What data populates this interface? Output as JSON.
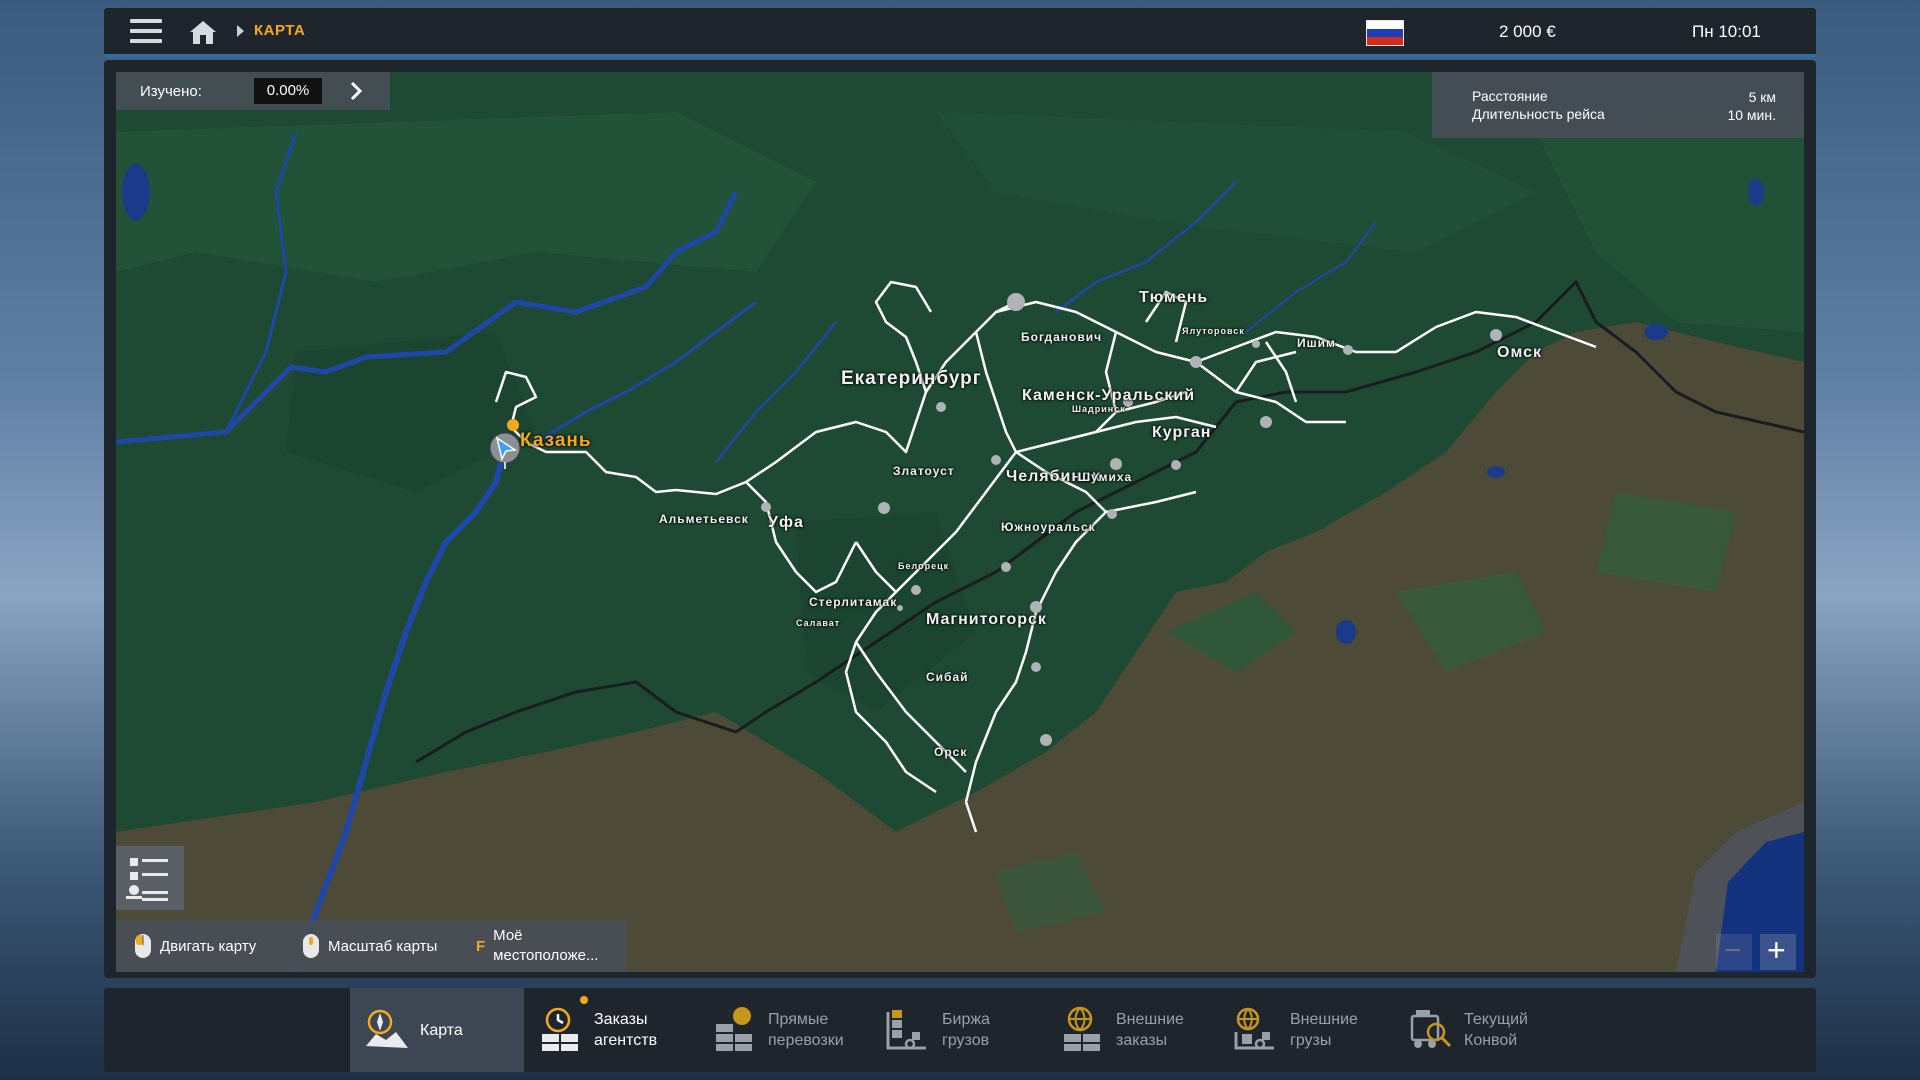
{
  "topbar": {
    "breadcrumb": "КАРТА",
    "money": "2 000 €",
    "time": "Пн 10:01",
    "flag_colors": [
      "#ffffff",
      "#1c3fb8",
      "#d52b1e"
    ]
  },
  "map": {
    "explored_label": "Изучено:",
    "explored_value": "0.00%",
    "route": {
      "distance_label": "Расстояние",
      "distance_value": "5 км",
      "duration_label": "Длительность рейса",
      "duration_value": "10 мин."
    },
    "cities": {
      "kazan": "Казань",
      "yekaterinburg": "Екатеринбург",
      "tyumen": "Тюмень",
      "bogdanovich": "Богданович",
      "yalutorovsk": "Ялуторовск",
      "ishim": "Ишим",
      "omsk": "Омск",
      "kamensk": "Каменск-Уральский",
      "shadrinsk": "Шадринск",
      "kurgan": "Курган",
      "zlatoust": "Златоуст",
      "chelyabinsk": "Челябинск",
      "shumikha": "Шумиха",
      "almetyevsk": "Альметьевск",
      "ufa": "Уфа",
      "yuzhnouralsk": "Южноуральск",
      "beloretsk": "Белорецк",
      "sterlitamak": "Стерлитамак",
      "salavat": "Салават",
      "magnitogorsk": "Магнитогорск",
      "sibai": "Сибай",
      "orsk": "Орск"
    },
    "hints": {
      "move": "Двигать карту",
      "zoom": "Масштаб карты",
      "key": "F",
      "my_location": "Моё местоположе..."
    },
    "zoom_out": "−",
    "zoom_in": "+"
  },
  "tabs": [
    {
      "line1": "Карта",
      "line2": ""
    },
    {
      "line1": "Заказы",
      "line2": "агентств"
    },
    {
      "line1": "Прямые",
      "line2": "перевозки"
    },
    {
      "line1": "Биржа",
      "line2": "грузов"
    },
    {
      "line1": "Внешние",
      "line2": "заказы"
    },
    {
      "line1": "Внешние",
      "line2": "грузы"
    },
    {
      "line1": "Текущий",
      "line2": "Конвой"
    }
  ],
  "colors": {
    "accent": "#f4a81c",
    "map_forest": "#1e4a33",
    "map_steppe": "#4d4a38",
    "water": "#1b3a8a",
    "panel": "#1f252d"
  }
}
